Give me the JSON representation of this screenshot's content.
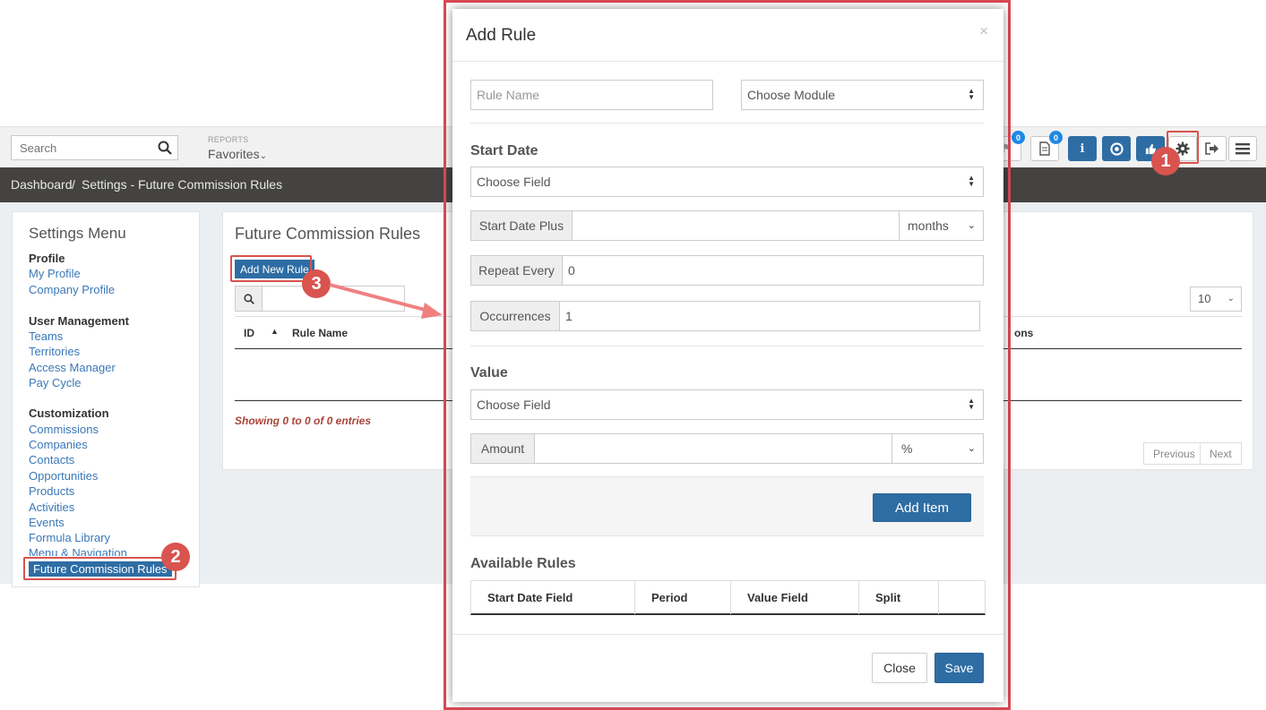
{
  "topbar": {
    "search_placeholder": "Search",
    "reports_label": "REPORTS",
    "favorites_label": "Favorites",
    "badge_1": "0",
    "badge_2": "0"
  },
  "breadcrumb": {
    "home": "Dashboard",
    "separator": "/",
    "current": "Settings - Future Commission Rules"
  },
  "settings_menu": {
    "title": "Settings Menu",
    "groups": [
      {
        "heading": "Profile",
        "items": [
          "My Profile",
          "Company Profile"
        ]
      },
      {
        "heading": "User Management",
        "items": [
          "Teams",
          "Territories",
          "Access Manager",
          "Pay Cycle"
        ]
      },
      {
        "heading": "Customization",
        "items": [
          "Commissions",
          "Companies",
          "Contacts",
          "Opportunities",
          "Products",
          "Activities",
          "Events",
          "Formula Library",
          "Menu & Navigation",
          "Future Commission Rules"
        ]
      }
    ]
  },
  "main": {
    "title": "Future Commission Rules",
    "add_button": "Add New Rule",
    "page_length": "10",
    "columns": [
      "ID",
      "Rule Name",
      "ons"
    ],
    "showing": "Showing 0 to 0 of 0 entries",
    "prev": "Previous",
    "next": "Next"
  },
  "annotations": [
    "1",
    "2",
    "3"
  ],
  "modal": {
    "title": "Add Rule",
    "close_x": "×",
    "rule_name_placeholder": "Rule Name",
    "module_select": "Choose Module",
    "start_date_heading": "Start Date",
    "start_field_select": "Choose Field",
    "start_date_plus_label": "Start Date Plus",
    "start_date_plus_value": "",
    "period_select": "months",
    "repeat_every_label": "Repeat Every",
    "repeat_every_value": "0",
    "occurrences_label": "Occurrences",
    "occurrences_value": "1",
    "value_heading": "Value",
    "value_field_select": "Choose Field",
    "amount_label": "Amount",
    "amount_value": "",
    "amount_unit_select": "%",
    "add_item_button": "Add Item",
    "available_rules_heading": "Available Rules",
    "rules_columns": [
      "Start Date Field",
      "Period",
      "Value Field",
      "Split"
    ],
    "close_button": "Close",
    "save_button": "Save"
  },
  "colors": {
    "primary": "#2e6da4",
    "annotation_red": "#d9534f",
    "breadcrumb_bg": "#444341"
  }
}
